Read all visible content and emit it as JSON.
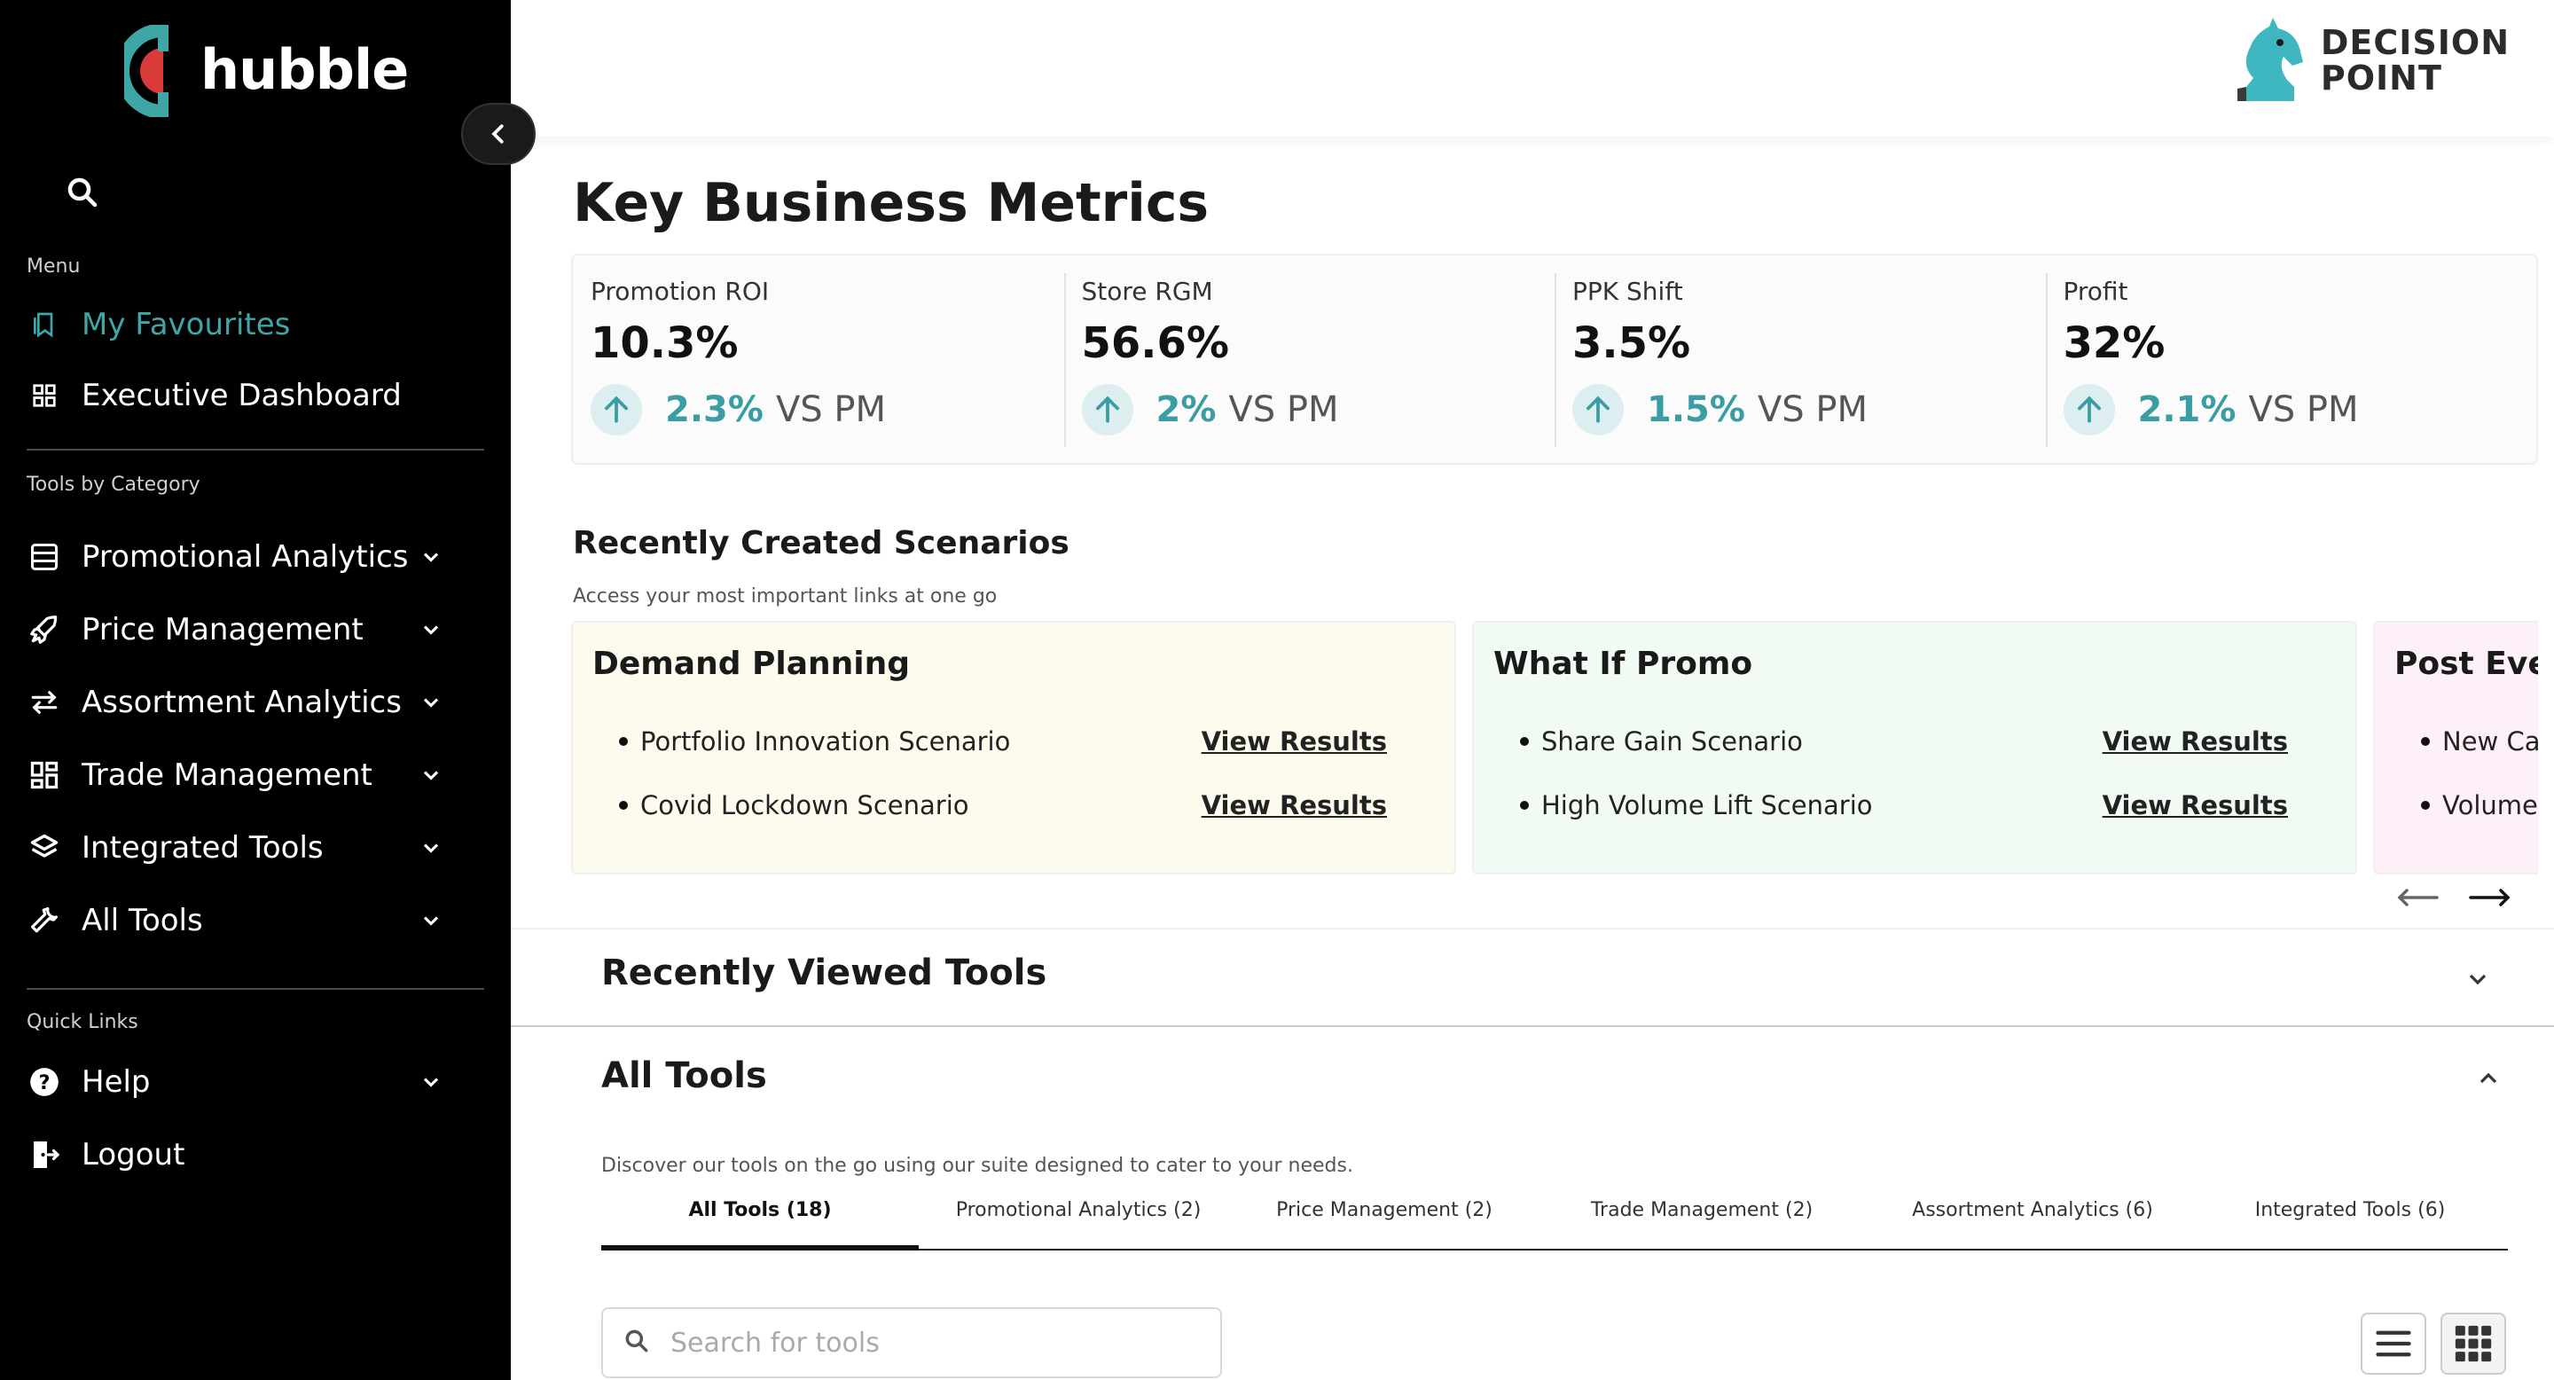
{
  "app": {
    "name": "hubble",
    "partner_logo_line1": "Decision",
    "partner_logo_line2": "Point"
  },
  "sidebar": {
    "menu_label": "Menu",
    "menu_items": [
      {
        "label": "My Favourites",
        "icon": "bookmark-icon",
        "active": true
      },
      {
        "label": "Executive Dashboard",
        "icon": "grid-icon"
      }
    ],
    "tools_label": "Tools by Category",
    "tool_items": [
      {
        "label": "Promotional Analytics",
        "icon": "list-icon"
      },
      {
        "label": "Price Management",
        "icon": "rocket-icon"
      },
      {
        "label": "Assortment Analytics",
        "icon": "swap-icon"
      },
      {
        "label": "Trade Management",
        "icon": "dashboard-icon"
      },
      {
        "label": "Integrated Tools",
        "icon": "layers-icon"
      },
      {
        "label": "All Tools",
        "icon": "wrench-icon"
      }
    ],
    "quick_label": "Quick Links",
    "quick_items": [
      {
        "label": "Help",
        "icon": "help-icon"
      },
      {
        "label": "Logout",
        "icon": "logout-icon"
      }
    ]
  },
  "main": {
    "title": "Key Business Metrics",
    "metrics": [
      {
        "label": "Promotion ROI",
        "value": "10.3%",
        "change": "2.3%",
        "suffix": "VS PM"
      },
      {
        "label": "Store RGM",
        "value": "56.6%",
        "change": "2%",
        "suffix": "VS PM"
      },
      {
        "label": "PPK Shift",
        "value": "3.5%",
        "change": "1.5%",
        "suffix": "VS PM"
      },
      {
        "label": "Profit",
        "value": "32%",
        "change": "2.1%",
        "suffix": "VS PM"
      }
    ],
    "scenarios": {
      "title": "Recently Created Scenarios",
      "subtitle": "Access your most important links at one go",
      "link_label": "View Results",
      "cards": [
        {
          "title": "Demand Planning",
          "bg": "#fdfbee",
          "items": [
            "Portfolio Innovation Scenario",
            "Covid Lockdown Scenario"
          ]
        },
        {
          "title": "What If Promo",
          "bg": "#f1fbf3",
          "items": [
            "Share Gain Scenario",
            "High Volume Lift Scenario"
          ]
        },
        {
          "title": "Post Eve",
          "bg": "#fdf0f8",
          "items": [
            "New Ca",
            "Volume"
          ]
        }
      ]
    },
    "recent_tools": {
      "title": "Recently Viewed Tools"
    },
    "all_tools": {
      "title": "All Tools",
      "subtitle": "Discover our tools on the go using our suite designed to cater to your needs.",
      "tabs": [
        "All Tools (18)",
        "Promotional Analytics (2)",
        "Price Management (2)",
        "Trade Management (2)",
        "Assortment Analytics (6)",
        "Integrated Tools (6)"
      ],
      "search_placeholder": "Search for tools"
    }
  },
  "colors": {
    "accent": "#3a9da4",
    "logo_red": "#d93a3a",
    "logo_teal": "#3fa6a8",
    "sidebar_bg": "#000000"
  }
}
